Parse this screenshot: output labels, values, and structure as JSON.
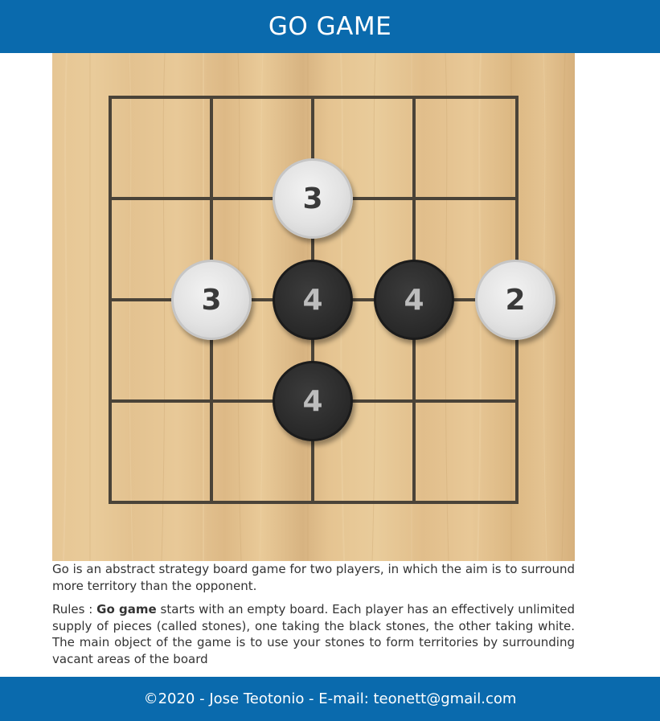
{
  "header": {
    "title": "GO GAME"
  },
  "board": {
    "size": 5,
    "stones": [
      {
        "color": "white",
        "label": "3",
        "row": 1,
        "col": 2
      },
      {
        "color": "white",
        "label": "3",
        "row": 2,
        "col": 1
      },
      {
        "color": "black",
        "label": "4",
        "row": 2,
        "col": 2
      },
      {
        "color": "black",
        "label": "4",
        "row": 2,
        "col": 3
      },
      {
        "color": "white",
        "label": "2",
        "row": 2,
        "col": 4
      },
      {
        "color": "black",
        "label": "4",
        "row": 3,
        "col": 2
      }
    ]
  },
  "content": {
    "intro": "Go is an abstract strategy board game for two players, in which the aim is to surround more territory than the opponent.",
    "rules_prefix": "Rules : ",
    "rules_bold": "Go game",
    "rules_rest": " starts with an empty board. Each player has an effectively unlimited supply of pieces (called stones), one taking the black stones, the other taking white. The main object of the game is to use your stones to form territories by surrounding vacant areas of the board"
  },
  "footer": {
    "text": "©2020 - Jose Teotonio - E-mail: teonett@gmail.com"
  },
  "colors": {
    "header_bg": "#0a6aad",
    "footer_bg": "#0a6aad",
    "grid_line": "#4a4338"
  }
}
